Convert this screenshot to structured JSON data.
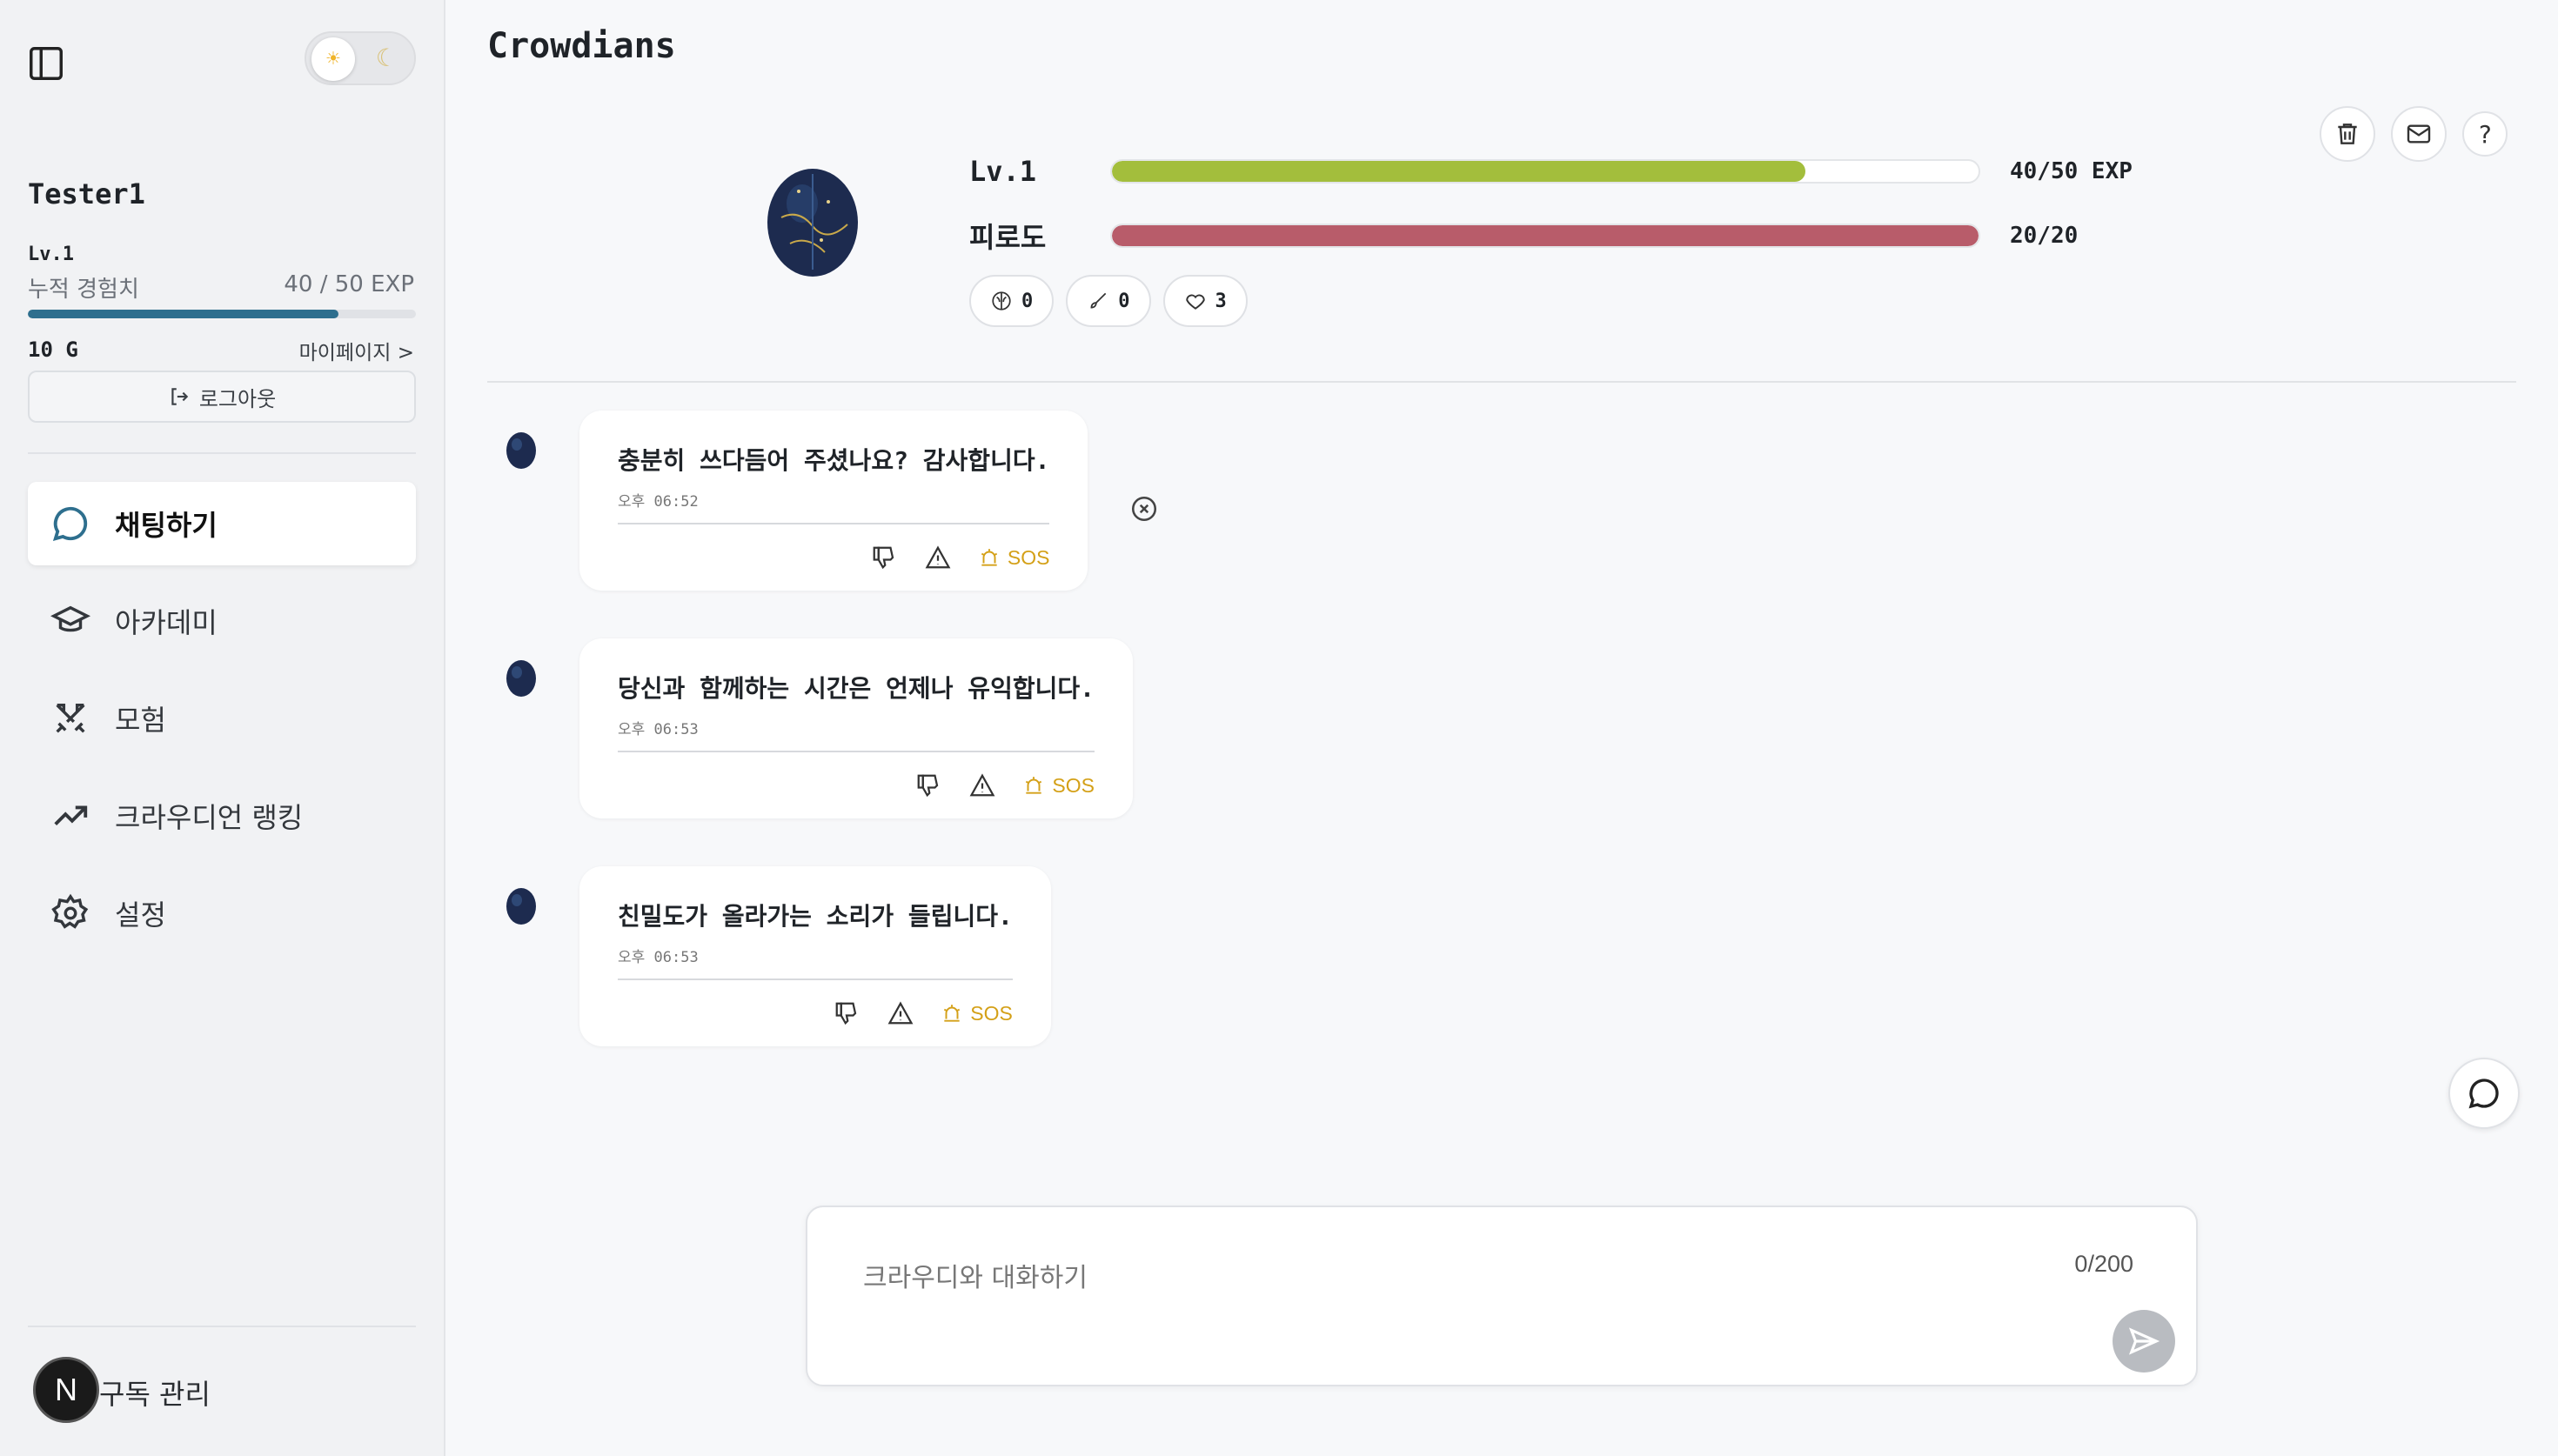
{
  "app": {
    "title": "Crowdians"
  },
  "sidebar": {
    "theme": {
      "light_icon": "sun-icon",
      "dark_icon": "moon-icon",
      "selected": "light"
    },
    "user": {
      "name": "Tester1",
      "level": "Lv.1",
      "exp_label": "누적 경험치",
      "exp_value": "40 / 50 EXP",
      "exp_progress": 0.8,
      "gold": "10 G",
      "mypage_label": "마이페이지 >",
      "logout_label": "로그아웃"
    },
    "nav": [
      {
        "label": "채팅하기",
        "icon": "chat-bubble-icon",
        "active": true
      },
      {
        "label": "아카데미",
        "icon": "graduation-cap-icon",
        "active": false
      },
      {
        "label": "모험",
        "icon": "crossed-swords-icon",
        "active": false
      },
      {
        "label": "크라우디언 랭킹",
        "icon": "trending-up-icon",
        "active": false
      },
      {
        "label": "설정",
        "icon": "gear-icon",
        "active": false
      }
    ],
    "footer": {
      "badge": "N",
      "label": "구독 관리"
    }
  },
  "pet": {
    "level_label": "Lv.1",
    "exp_text": "40/50 EXP",
    "exp_progress": 0.8,
    "fatigue_label": "피로도",
    "fatigue_text": "20/20",
    "fatigue_progress": 1.0,
    "colors": {
      "exp": "#a3be3c",
      "fatigue": "#b85c6a"
    },
    "chips": [
      {
        "icon": "brain-icon",
        "value": "0"
      },
      {
        "icon": "brush-icon",
        "value": "0"
      },
      {
        "icon": "heart-icon",
        "value": "3"
      }
    ]
  },
  "toolbar": {
    "icons": [
      "trash-icon",
      "mail-icon",
      "help-icon"
    ],
    "help_label": "?"
  },
  "messages": [
    {
      "text": "충분히 쓰다듬어 주셨나요? 감사합니다.",
      "time": "오후 06:52",
      "sos": "SOS"
    },
    {
      "text": "당신과 함께하는 시간은 언제나 유익합니다.",
      "time": "오후 06:53",
      "sos": "SOS"
    },
    {
      "text": "친밀도가 올라가는 소리가 들립니다.",
      "time": "오후 06:53",
      "sos": "SOS"
    }
  ],
  "composer": {
    "placeholder": "크라우디와 대화하기",
    "count": "0/200"
  }
}
